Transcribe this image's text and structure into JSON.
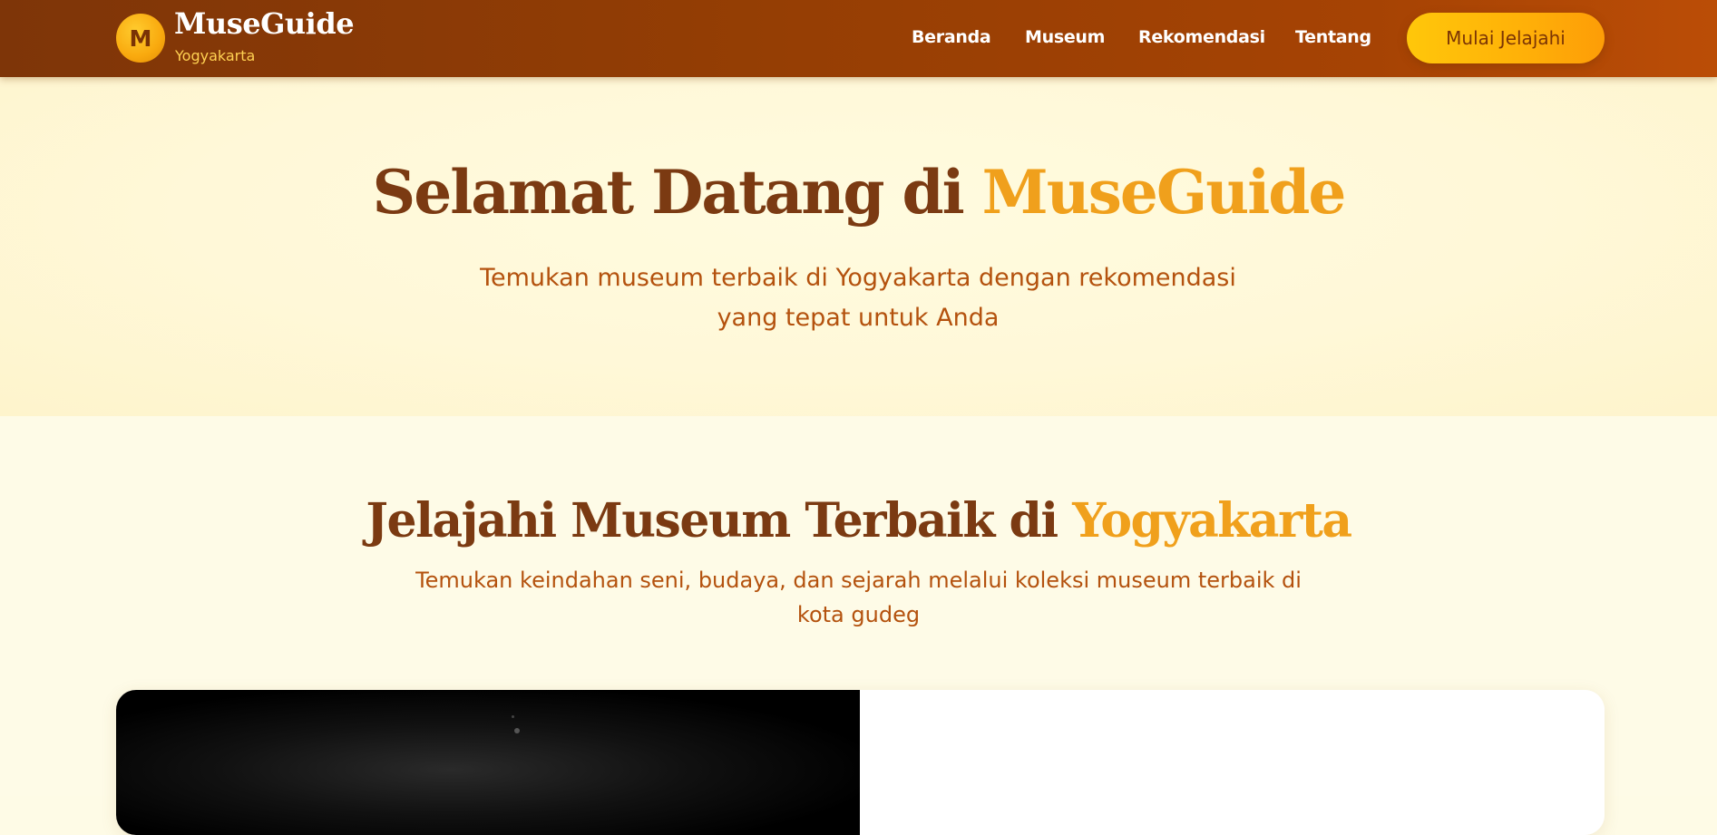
{
  "header": {
    "logo_letter": "M",
    "brand_name": "MuseGuide",
    "brand_city": "Yogyakarta",
    "menu": [
      {
        "label": "Beranda"
      },
      {
        "label": "Museum"
      },
      {
        "label": "Rekomendasi"
      },
      {
        "label": "Tentang"
      }
    ],
    "cta_label": "Mulai Jelajahi"
  },
  "hero": {
    "title_main": "Selamat Datang di ",
    "title_accent": "MuseGuide",
    "subtitle": "Temukan museum terbaik di Yogyakarta dengan rekomendasi yang tepat untuk Anda"
  },
  "explore": {
    "title_main": "Jelajahi Museum Terbaik di ",
    "title_accent": "Yogyakarta",
    "subtitle": "Temukan keindahan seni, budaya, dan sejarah melalui koleksi museum terbaik di kota gudeg"
  },
  "colors": {
    "header_start": "#7e3508",
    "header_end": "#bb4d06",
    "accent": "#f0a01c",
    "title_brown": "#7b3a12",
    "subtitle_orange": "#b4520e",
    "cta_yellow": "#ffc70a"
  }
}
